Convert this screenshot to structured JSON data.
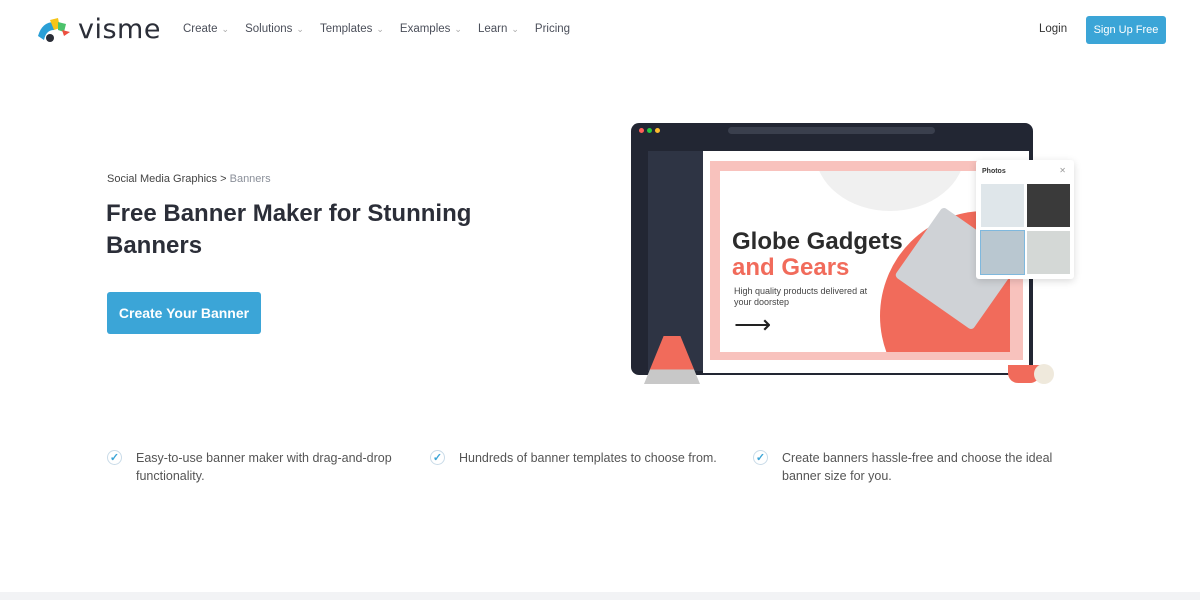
{
  "brand": {
    "name": "visme",
    "colors": {
      "accent": "#3ba5d7",
      "coral": "#f16b5b",
      "dark": "#2b2e38"
    }
  },
  "nav": {
    "items": [
      {
        "label": "Create",
        "dropdown": true
      },
      {
        "label": "Solutions",
        "dropdown": true
      },
      {
        "label": "Templates",
        "dropdown": true
      },
      {
        "label": "Examples",
        "dropdown": true
      },
      {
        "label": "Learn",
        "dropdown": true
      },
      {
        "label": "Pricing",
        "dropdown": false
      }
    ],
    "login": "Login",
    "signup": "Sign Up Free"
  },
  "hero": {
    "breadcrumb": {
      "parent": "Social Media Graphics",
      "separator": " > ",
      "current": "Banners"
    },
    "title": "Free Banner Maker for Stunning Banners",
    "cta": "Create Your Banner"
  },
  "mockup": {
    "headline1": "Globe Gadgets",
    "headline2": "and Gears",
    "subtext": "High quality products delivered at your doorstep",
    "photos_panel": "Photos",
    "close": "✕"
  },
  "features": [
    {
      "icon": "check-circle-icon",
      "text": "Easy-to-use banner maker with drag-and-drop functionality."
    },
    {
      "icon": "check-circle-icon",
      "text": "Hundreds of banner templates to choose from."
    },
    {
      "icon": "check-circle-icon",
      "text": "Create banners hassle-free and choose the ideal banner size for you."
    }
  ]
}
